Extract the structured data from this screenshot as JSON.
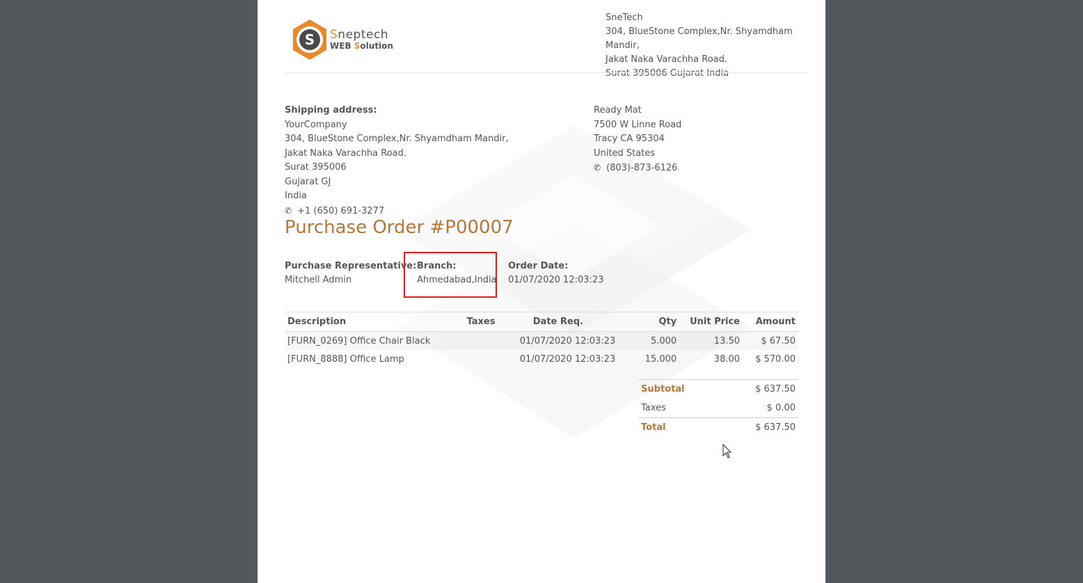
{
  "brand": {
    "name_prefix": "S",
    "name_rest": "neptech",
    "sub_web": "WEB ",
    "sub_s": "S",
    "sub_rest": "olution"
  },
  "company": {
    "name": "SneTech",
    "address1": "304, BlueStone Complex,Nr. Shyamdham Mandir,",
    "address2": "Jakat Naka Varachha Road.",
    "address3": "Surat 395006 Gujarat India"
  },
  "shipping": {
    "label": "Shipping address:",
    "name": "YourCompany",
    "line1": "304, BlueStone Complex,Nr. Shyamdham Mandir,",
    "line2": "Jakat Naka Varachha Road.",
    "line3": "Surat 395006",
    "line4": "Gujarat GJ",
    "line5": "India",
    "phone": "+1 (650) 691-3277"
  },
  "vendor": {
    "name": "Ready Mat",
    "line1": "7500 W Linne Road",
    "line2": "Tracy CA 95304",
    "line3": "United States",
    "phone": "(803)-873-6126"
  },
  "title": "Purchase Order #P00007",
  "info": {
    "rep_label": "Purchase Representative:",
    "rep_value": "Mitchell Admin",
    "branch_label": "Branch:",
    "branch_value": "Ahmedabad,India",
    "date_label": "Order Date:",
    "date_value": "01/07/2020 12:03:23"
  },
  "table": {
    "headers": [
      "Description",
      "Taxes",
      "Date Req.",
      "Qty",
      "Unit Price",
      "Amount"
    ],
    "rows": [
      [
        "[FURN_0269] Office Chair Black",
        "",
        "01/07/2020 12:03:23",
        "5.000",
        "13.50",
        "$ 67.50"
      ],
      [
        "[FURN_8888] Office Lamp",
        "",
        "01/07/2020 12:03:23",
        "15.000",
        "38.00",
        "$ 570.00"
      ]
    ]
  },
  "totals": {
    "subtotal_label": "Subtotal",
    "subtotal_value": "$ 637.50",
    "taxes_label": "Taxes",
    "taxes_value": "$ 0.00",
    "total_label": "Total",
    "total_value": "$ 637.50"
  },
  "icons": {
    "phone": "phone-icon",
    "logo": "sneptech-logo",
    "cursor": "mouse-cursor"
  },
  "colors": {
    "accent": "#b5773a",
    "highlight": "#e01b1b",
    "logo_orange": "#e8892a",
    "background": "#52575c"
  }
}
